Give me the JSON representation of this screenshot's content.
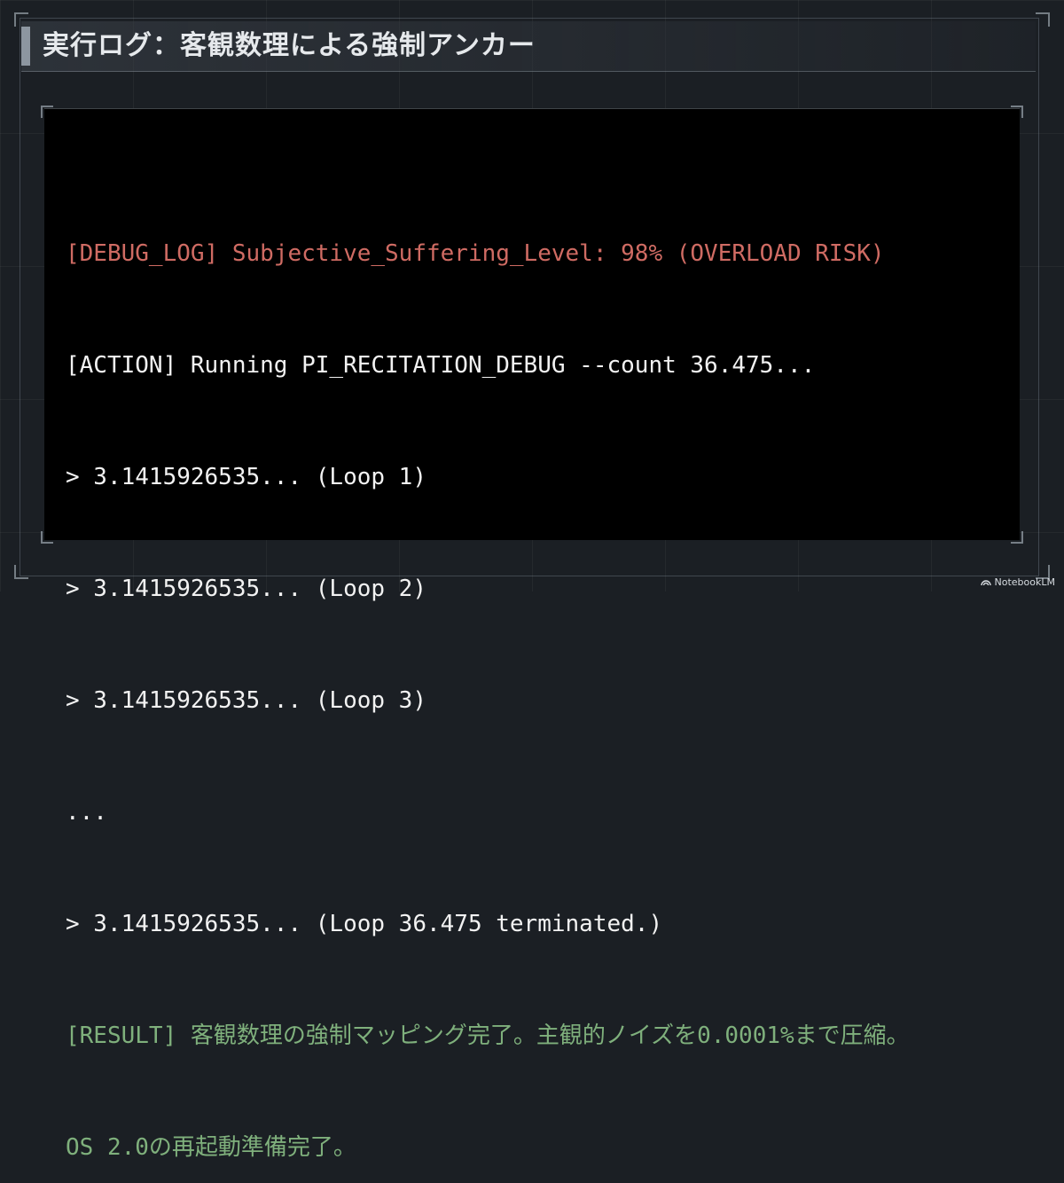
{
  "slide": {
    "title": "実行ログ：客観数理による強制アンカー"
  },
  "terminal": {
    "lines": [
      {
        "text": "[DEBUG_LOG] Subjective_Suffering_Level: 98% (OVERLOAD RISK)",
        "color": "#cf6b63"
      },
      {
        "text": "[ACTION] Running PI_RECITATION_DEBUG --count 36.475...",
        "color": "#f2f2f2"
      },
      {
        "text": "> 3.1415926535... (Loop 1)",
        "color": "#f2f2f2"
      },
      {
        "text": "> 3.1415926535... (Loop 2)",
        "color": "#f2f2f2"
      },
      {
        "text": "> 3.1415926535... (Loop 3)",
        "color": "#f2f2f2"
      },
      {
        "text": "...",
        "color": "#f2f2f2"
      },
      {
        "text": "> 3.1415926535... (Loop 36.475 terminated.)",
        "color": "#f2f2f2"
      },
      {
        "text": "[RESULT] 客観数理の強制マッピング完了。主観的ノイズを0.0001%まで圧縮。",
        "color": "#7fb07c"
      },
      {
        "text": "OS 2.0の再起動準備完了。",
        "color": "#7fb07c"
      }
    ]
  },
  "watermark": {
    "label": "NotebookLM",
    "icon": "notebooklm-logo-icon"
  }
}
